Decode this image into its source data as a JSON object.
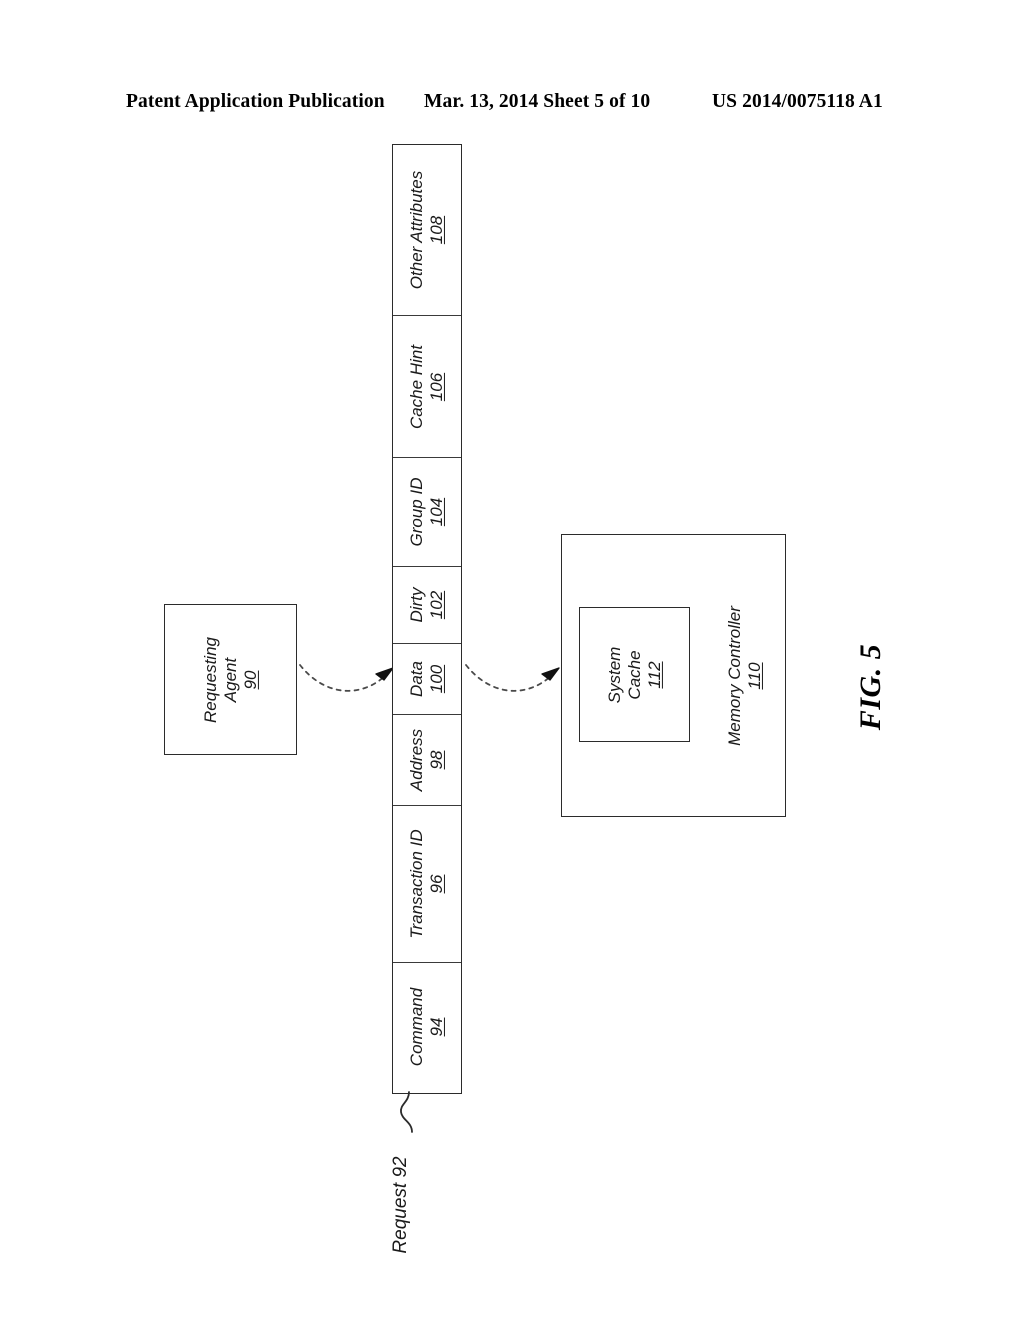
{
  "header": {
    "left": "Patent Application Publication",
    "middle": "Mar. 13, 2014  Sheet 5 of 10",
    "right": "US 2014/0075118 A1"
  },
  "figure": {
    "label": "FIG. 5",
    "requesting_agent": {
      "line1": "Requesting",
      "line2": "Agent",
      "ref": "90"
    },
    "request_label": "Request 92",
    "memory_controller": {
      "line1": "Memory Controller",
      "ref": "110"
    },
    "system_cache": {
      "line1": "System",
      "line2": "Cache",
      "ref": "112"
    },
    "request_fields": [
      {
        "label": "Other Attributes",
        "ref": "108"
      },
      {
        "label": "Cache Hint",
        "ref": "106"
      },
      {
        "label": "Group ID",
        "ref": "104"
      },
      {
        "label": "Dirty",
        "ref": "102"
      },
      {
        "label": "Data",
        "ref": "100"
      },
      {
        "label": "Address",
        "ref": "98"
      },
      {
        "label": "Transaction ID",
        "ref": "96"
      },
      {
        "label": "Command",
        "ref": "94"
      }
    ]
  },
  "colors": {
    "ink": "#000000",
    "line": "#2b2b2b",
    "paper": "#ffffff"
  }
}
